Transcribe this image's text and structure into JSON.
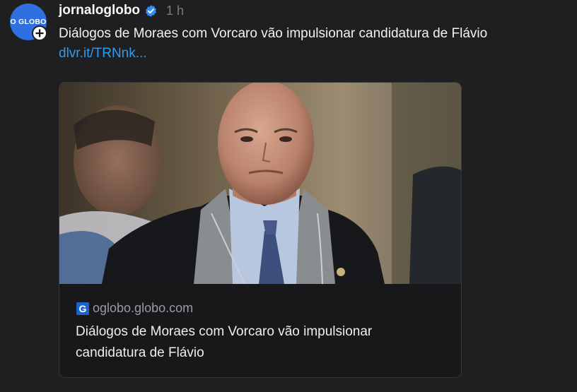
{
  "post": {
    "avatar_text": "O GLOBO",
    "handle": "jornaloglobo",
    "time": "1 h",
    "text": "Diálogos de Moraes com Vorcaro vão impulsionar candidatura de Flávio ",
    "link_text": "dlvr.it/TRNnk..."
  },
  "card": {
    "domain": "oglobo.globo.com",
    "favicon_letter": "G",
    "title": "Diálogos de Moraes com Vorcaro vão impulsionar candidatura de Flávio"
  },
  "colors": {
    "background": "#1f1f21",
    "link": "#2f9bea",
    "verified": "#2f8ef0",
    "avatar": "#2f6fe0"
  },
  "icons": {
    "verified": "verified-badge-icon",
    "follow": "plus-icon",
    "favicon": "globo-g-icon"
  }
}
